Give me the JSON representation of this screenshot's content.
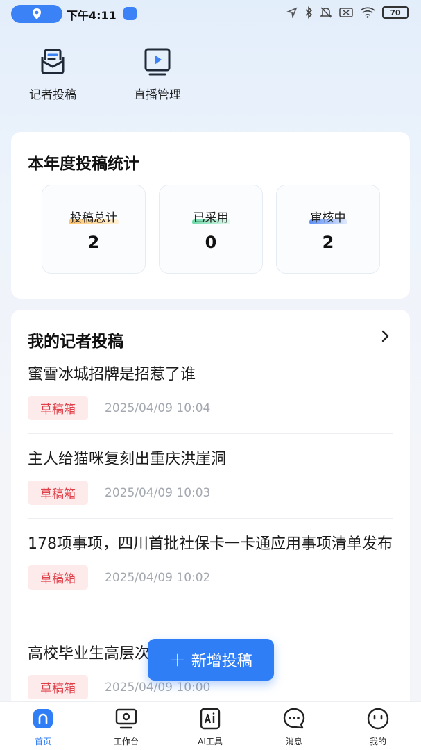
{
  "status_bar": {
    "time": "下午4:11",
    "battery": "70"
  },
  "quick_actions": [
    {
      "label": "记者投稿",
      "icon": "mail-icon"
    },
    {
      "label": "直播管理",
      "icon": "live-icon"
    }
  ],
  "stats": {
    "title": "本年度投稿统计",
    "items": [
      {
        "label": "投稿总计",
        "value": "2",
        "accent": "#ffb84d"
      },
      {
        "label": "已采用",
        "value": "0",
        "accent": "#3fcf8e"
      },
      {
        "label": "审核中",
        "value": "2",
        "accent": "#3b7ef5"
      }
    ]
  },
  "submissions": {
    "title": "我的记者投稿",
    "items": [
      {
        "title": "蜜雪冰城招牌是招惹了谁",
        "badge": "草稿箱",
        "time": "2025/04/09 10:04"
      },
      {
        "title": "主人给猫咪复刻出重庆洪崖洞",
        "badge": "草稿箱",
        "time": "2025/04/09 10:03"
      },
      {
        "title": "178项事项，四川首批社保卡一卡通应用事项清单发布",
        "badge": "草稿箱",
        "time": "2025/04/09 10:02"
      },
      {
        "title": "高校毕业生高层次人才大礼包来了",
        "badge": "草稿箱",
        "time": "2025/04/09 10:00"
      }
    ]
  },
  "fab": {
    "label": "新增投稿"
  },
  "bottom_nav": [
    {
      "label": "首页",
      "active": true
    },
    {
      "label": "工作台",
      "active": false
    },
    {
      "label": "AI工具",
      "active": false
    },
    {
      "label": "消息",
      "active": false
    },
    {
      "label": "我的",
      "active": false
    }
  ],
  "colors": {
    "primary": "#2f7ef5",
    "badge_bg": "#fdeaea",
    "badge_text": "#e0404a"
  }
}
